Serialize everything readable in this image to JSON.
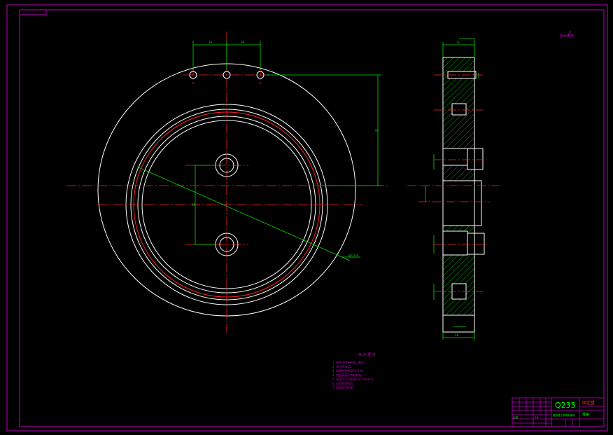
{
  "title_block": {
    "material": "Q235",
    "part_name": "固定盘",
    "drawing_name": "端盖",
    "school": "洛阳理工学院机械系",
    "scale_label": "比例",
    "scale_value": "1:1"
  },
  "notes": {
    "heading": "技 术 要 求",
    "items": [
      "1. 铸件不得有砂眼、裂纹。",
      "2. 未注倒角C1。",
      "3. 调质处理HB220-250。",
      "4. 加工表面不得有划痕。",
      "5. 未注尺寸公差按GB/T1804-m。",
      "6. 去除毛刺锐边。",
      "7. 表面发黑处理。"
    ]
  },
  "corner_note": "技术要求",
  "dims": {
    "top_left": "36",
    "top_right": "36",
    "vertical_right": "95",
    "hole_spacing": "58",
    "leader": "φ214.6",
    "side_top": "12",
    "side_bottom": "28"
  },
  "colors": {
    "border": "#c000c0",
    "geometry": "#ffffff",
    "centerline": "#ff2020",
    "dimension": "#00e000",
    "hatch": "#00c000",
    "notes": "#c000c0",
    "material": "#00ff00",
    "title": "#ff3030"
  }
}
